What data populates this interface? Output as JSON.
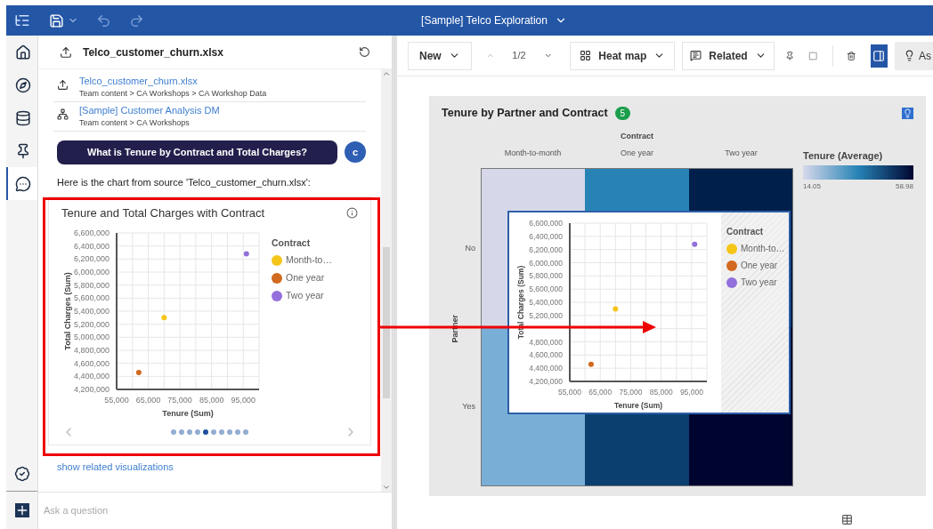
{
  "topbar": {
    "title": "[Sample] Telco Exploration"
  },
  "rail_items": [
    {
      "selected": false
    },
    {
      "selected": false
    },
    {
      "selected": false
    },
    {
      "selected": false
    },
    {
      "selected": true
    }
  ],
  "assistant": {
    "header": "Telco_customer_churn.xlsx",
    "sources": [
      {
        "name": "Telco_customer_churn.xlsx",
        "path": "Team content > CA Workshops > CA Workshop Data"
      },
      {
        "name": "[Sample] Customer Analysis DM",
        "path": "Team content > CA Workshops"
      }
    ],
    "question": {
      "text": "What is Tenure by Contract and Total Charges?",
      "avatar": "c"
    },
    "answer": "Here is the chart from source 'Telco_customer_churn.xlsx':",
    "card": {
      "title": "Tenure and Total Charges with Contract",
      "legend_title": "Contract",
      "chart_data": {
        "type": "scatter",
        "grid": true,
        "xlabel": "Tenure (Sum)",
        "ylabel": "Total Charges (Sum)",
        "xlim": [
          55000,
          100000
        ],
        "ylim": [
          4200000,
          6600000
        ],
        "xticks": [
          {
            "value": 55000,
            "label": "55,000"
          },
          {
            "value": 65000,
            "label": "65,000"
          },
          {
            "value": 75000,
            "label": "75,000"
          },
          {
            "value": 85000,
            "label": "85,000"
          },
          {
            "value": 95000,
            "label": "95,000"
          }
        ],
        "yticks": [
          {
            "value": 4200000,
            "label": "4,200,000"
          },
          {
            "value": 4400000,
            "label": "4,400,000"
          },
          {
            "value": 4600000,
            "label": "4,600,000"
          },
          {
            "value": 4800000,
            "label": "4,800,000"
          },
          {
            "value": 5000000,
            "label": "5,000,000"
          },
          {
            "value": 5200000,
            "label": "5,200,000"
          },
          {
            "value": 5400000,
            "label": "5,400,000"
          },
          {
            "value": 5600000,
            "label": "5,600,000"
          },
          {
            "value": 5800000,
            "label": "5,800,000"
          },
          {
            "value": 6000000,
            "label": "6,000,000"
          },
          {
            "value": 6200000,
            "label": "6,200,000"
          },
          {
            "value": 6400000,
            "label": "6,400,000"
          },
          {
            "value": 6600000,
            "label": "6,600,000"
          }
        ],
        "series": [
          {
            "name": "Month-to…",
            "color": "#f5c518",
            "x": [
              70000
            ],
            "values": [
              5300000
            ]
          },
          {
            "name": "One year",
            "color": "#d2691e",
            "x": [
              62000
            ],
            "values": [
              4460000
            ]
          },
          {
            "name": "Two year",
            "color": "#9370db",
            "x": [
              96000
            ],
            "values": [
              6280000
            ]
          }
        ]
      },
      "dots": [
        {
          "selected": false
        },
        {
          "selected": false
        },
        {
          "selected": false
        },
        {
          "selected": false
        },
        {
          "selected": true
        },
        {
          "selected": false
        },
        {
          "selected": false
        },
        {
          "selected": false
        },
        {
          "selected": false
        },
        {
          "selected": false
        }
      ]
    },
    "related_link": "show related visualizations",
    "ask": {
      "placeholder": "Ask a question"
    }
  },
  "toolbar": {
    "new": "New",
    "page": "1/2",
    "viz": "Heat map",
    "related": "Related",
    "panel_toggle": {
      "selected": true
    },
    "ask": "As"
  },
  "visualization": {
    "title": "Tenure by Partner and Contract",
    "badge": "5",
    "heatmap": {
      "column_title": "Contract",
      "columns": [
        "Month-to-month",
        "One year",
        "Two year"
      ],
      "row_title": "Partner",
      "rows": [
        {
          "label": "No",
          "cells": [
            {
              "color": "#d6d8ea"
            },
            {
              "color": "#2783b6"
            },
            {
              "color": "#00204b"
            }
          ]
        },
        {
          "label": "Yes",
          "cells": [
            {
              "color": "#79afd6"
            },
            {
              "color": "#0b3f70"
            },
            {
              "color": "#000530"
            }
          ]
        }
      ]
    },
    "legend": {
      "title": "Tenure (Average)",
      "min": "14.05",
      "max": "58.98"
    }
  },
  "inset": {
    "legend_title": "Contract",
    "chart_data": {
      "type": "scatter",
      "grid": true,
      "xlabel": "Tenure (Sum)",
      "ylabel": "Total Charges (Sum)",
      "xlim": [
        55000,
        100000
      ],
      "ylim": [
        4200000,
        6600000
      ],
      "xticks": [
        {
          "value": 55000,
          "label": "55,000"
        },
        {
          "value": 65000,
          "label": "65,000"
        },
        {
          "value": 75000,
          "label": "75,000"
        },
        {
          "value": 85000,
          "label": "85,000"
        },
        {
          "value": 95000,
          "label": "95,000"
        }
      ],
      "yticks": [
        {
          "value": 4200000,
          "label": "4,200,000"
        },
        {
          "value": 4400000,
          "label": "4,400,000"
        },
        {
          "value": 4600000,
          "label": "4,600,000"
        },
        {
          "value": 4800000,
          "label": "4,800,000"
        },
        {
          "value": 5200000,
          "label": "5,200,000"
        },
        {
          "value": 5400000,
          "label": "5,400,000"
        },
        {
          "value": 5600000,
          "label": "5,600,000"
        },
        {
          "value": 5800000,
          "label": "5,800,000"
        },
        {
          "value": 6000000,
          "label": "6,000,000"
        },
        {
          "value": 6200000,
          "label": "6,200,000"
        },
        {
          "value": 6400000,
          "label": "6,400,000"
        },
        {
          "value": 6600000,
          "label": "6,600,000"
        }
      ],
      "series": [
        {
          "name": "Month-to…",
          "color": "#f5c518",
          "x": [
            70000
          ],
          "values": [
            5300000
          ]
        },
        {
          "name": "One year",
          "color": "#d2691e",
          "x": [
            62000
          ],
          "values": [
            4460000
          ]
        },
        {
          "name": "Two year",
          "color": "#9370db",
          "x": [
            96000
          ],
          "values": [
            6280000
          ]
        }
      ]
    }
  }
}
